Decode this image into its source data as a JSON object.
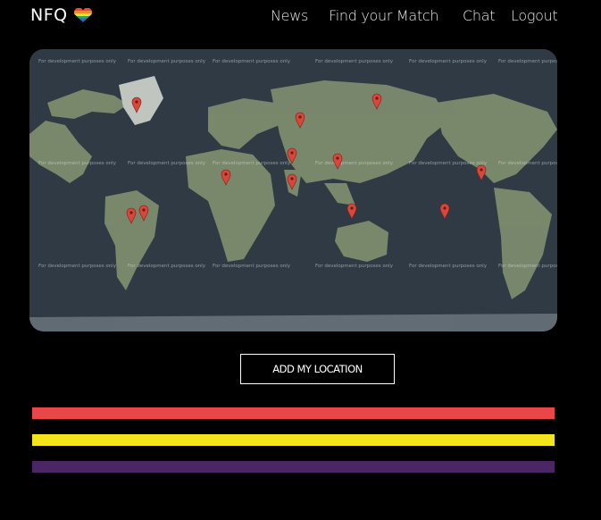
{
  "brand": {
    "name": "NFQ"
  },
  "nav": {
    "news": "News",
    "find_match": "Find your Match",
    "chat": "Chat",
    "logout": "Logout"
  },
  "map": {
    "watermark": "For development purposes only",
    "ocean_color": "#2f3a45",
    "land_color": "#8b9a7a",
    "marker_color": "#d9473b",
    "marker_count": 13
  },
  "actions": {
    "add_location": "ADD MY LOCATION"
  },
  "stripes": {
    "colors": [
      "#e94747",
      "#f3e41b",
      "#4a2665"
    ]
  }
}
